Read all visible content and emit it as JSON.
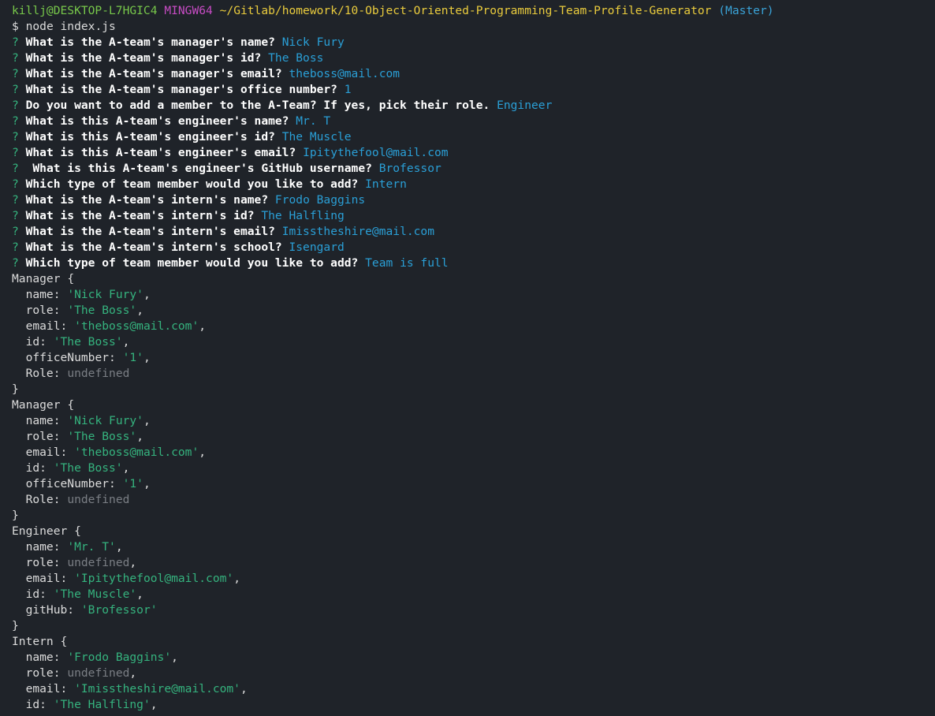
{
  "prompt": {
    "user_host": "killj@DESKTOP-L7HGIC4",
    "shell": "MINGW64",
    "path": "~/Gitlab/homework/10-Object-Oriented-Programming-Team-Profile-Generator",
    "branch": "(Master)",
    "dollar": "$",
    "command": "node index.js"
  },
  "qa": [
    {
      "mark": "?",
      "q": "What is the A-team's manager's name?",
      "a": "Nick Fury"
    },
    {
      "mark": "?",
      "q": "What is the A-team's manager's id?",
      "a": "The Boss"
    },
    {
      "mark": "?",
      "q": "What is the A-team's manager's email?",
      "a": "theboss@mail.com"
    },
    {
      "mark": "?",
      "q": "What is the A-team's manager's office number?",
      "a": "1"
    },
    {
      "mark": "?",
      "q": "Do you want to add a member to the A-Team? If yes, pick their role.",
      "a": "Engineer"
    },
    {
      "mark": "?",
      "q": "What is this A-team's engineer's name?",
      "a": "Mr. T"
    },
    {
      "mark": "?",
      "q": "What is this A-team's engineer's id?",
      "a": "The Muscle"
    },
    {
      "mark": "?",
      "q": "What is this A-team's engineer's email?",
      "a": "Ipitythefool@mail.com"
    },
    {
      "mark": "?",
      "q": " What is this A-team's engineer's GitHub username?",
      "a": "Brofessor"
    },
    {
      "mark": "?",
      "q": "Which type of team member would you like to add?",
      "a": "Intern"
    },
    {
      "mark": "?",
      "q": "What is the A-team's intern's name?",
      "a": "Frodo Baggins"
    },
    {
      "mark": "?",
      "q": "What is the A-team's intern's id?",
      "a": "The Halfling"
    },
    {
      "mark": "?",
      "q": "What is the A-team's intern's email?",
      "a": "Imisstheshire@mail.com"
    },
    {
      "mark": "?",
      "q": "What is the A-team's intern's school?",
      "a": "Isengard"
    },
    {
      "mark": "?",
      "q": "Which type of team member would you like to add?",
      "a": "Team is full"
    }
  ],
  "objects": [
    {
      "name": "Manager",
      "open": "{",
      "close": "}",
      "props": [
        {
          "key": "name",
          "value": "'Nick Fury'",
          "kind": "str",
          "comma": true
        },
        {
          "key": "role",
          "value": "'The Boss'",
          "kind": "str",
          "comma": true
        },
        {
          "key": "email",
          "value": "'theboss@mail.com'",
          "kind": "str",
          "comma": true
        },
        {
          "key": "id",
          "value": "'The Boss'",
          "kind": "str",
          "comma": true
        },
        {
          "key": "officeNumber",
          "value": "'1'",
          "kind": "str",
          "comma": true
        },
        {
          "key": "Role",
          "value": "undefined",
          "kind": "undef",
          "comma": false
        }
      ]
    },
    {
      "name": "Manager",
      "open": "{",
      "close": "}",
      "props": [
        {
          "key": "name",
          "value": "'Nick Fury'",
          "kind": "str",
          "comma": true
        },
        {
          "key": "role",
          "value": "'The Boss'",
          "kind": "str",
          "comma": true
        },
        {
          "key": "email",
          "value": "'theboss@mail.com'",
          "kind": "str",
          "comma": true
        },
        {
          "key": "id",
          "value": "'The Boss'",
          "kind": "str",
          "comma": true
        },
        {
          "key": "officeNumber",
          "value": "'1'",
          "kind": "str",
          "comma": true
        },
        {
          "key": "Role",
          "value": "undefined",
          "kind": "undef",
          "comma": false
        }
      ]
    },
    {
      "name": "Engineer",
      "open": "{",
      "close": "}",
      "props": [
        {
          "key": "name",
          "value": "'Mr. T'",
          "kind": "str",
          "comma": true
        },
        {
          "key": "role",
          "value": "undefined",
          "kind": "undef",
          "comma": true
        },
        {
          "key": "email",
          "value": "'Ipitythefool@mail.com'",
          "kind": "str",
          "comma": true
        },
        {
          "key": "id",
          "value": "'The Muscle'",
          "kind": "str",
          "comma": true
        },
        {
          "key": "gitHub",
          "value": "'Brofessor'",
          "kind": "str",
          "comma": false
        }
      ]
    },
    {
      "name": "Intern",
      "open": "{",
      "close": "",
      "props": [
        {
          "key": "name",
          "value": "'Frodo Baggins'",
          "kind": "str",
          "comma": true
        },
        {
          "key": "role",
          "value": "undefined",
          "kind": "undef",
          "comma": true
        },
        {
          "key": "email",
          "value": "'Imisstheshire@mail.com'",
          "kind": "str",
          "comma": true
        },
        {
          "key": "id",
          "value": "'The Halfling'",
          "kind": "str",
          "comma": true
        }
      ]
    }
  ],
  "colors": {
    "background": "#1f2329",
    "user_host": "#77c74a",
    "shell": "#c74cc4",
    "path": "#e9cb3d",
    "branch": "#3aa3d8",
    "answer": "#2a9fd6",
    "string": "#35b37e",
    "undefined": "#7a7e84"
  }
}
